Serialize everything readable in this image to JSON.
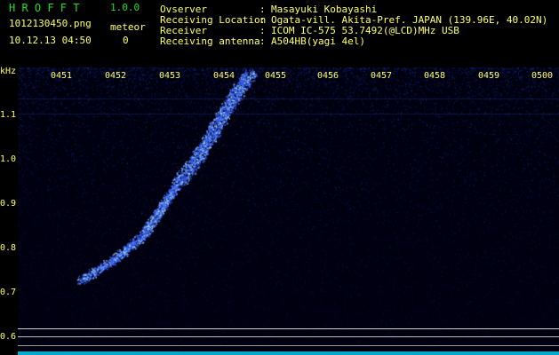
{
  "header": {
    "app_title": "H R O F F T",
    "app_version": "1.0.0",
    "file_name": "1012130450.png",
    "meteor_label": "meteor",
    "timestamp": "10.12.13 04:50",
    "meteor_count": "0"
  },
  "info": [
    {
      "label": "Ovserver",
      "value": "Masayuki Kobayashi"
    },
    {
      "label": "Receiving Location",
      "value": "Ogata-vill. Akita-Pref. JAPAN (139.96E, 40.02N)"
    },
    {
      "label": "Receiver",
      "value": "ICOM IC-575 53.7492(@LCD)MHz USB"
    },
    {
      "label": "Receiving antenna",
      "value": "A504HB(yagi 4el)"
    }
  ],
  "separator": ":",
  "axis": {
    "y_unit": "kHz",
    "x_ticks": [
      "0451",
      "0452",
      "0453",
      "0454",
      "0455",
      "0456",
      "0457",
      "0458",
      "0459",
      "0500"
    ],
    "y_ticks": [
      "1.1",
      "1.0",
      "0.9",
      "0.8",
      "0.7",
      "0.6"
    ]
  },
  "colors": {
    "title": "#22dd22",
    "text": "#ffff66",
    "signal": "#3a5bff",
    "signal_bright": "#9fdcff",
    "background": "#000010",
    "bottom_bar": "#00aacc"
  }
}
